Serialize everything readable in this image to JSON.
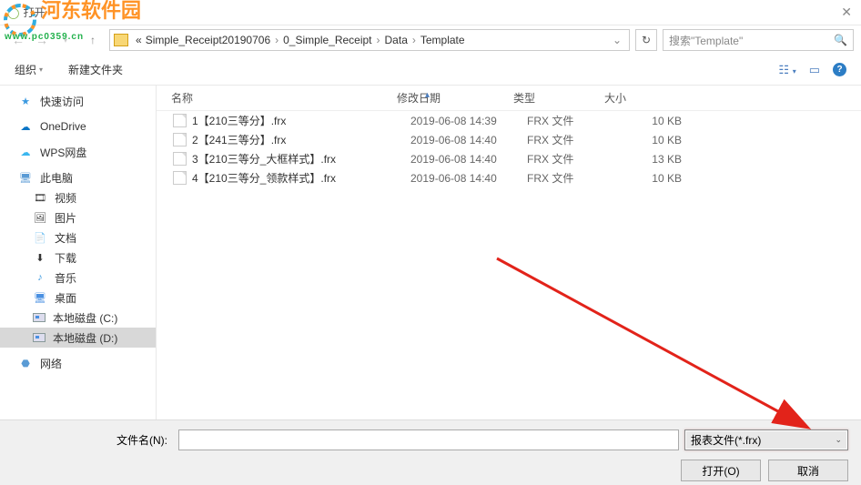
{
  "titlebar": {
    "title": "打开"
  },
  "breadcrumb": {
    "prefix": "«",
    "items": [
      "Simple_Receipt20190706",
      "0_Simple_Receipt",
      "Data",
      "Template"
    ]
  },
  "search": {
    "placeholder": "搜索\"Template\""
  },
  "toolbar": {
    "organize": "组织",
    "newfolder": "新建文件夹"
  },
  "sidebar": {
    "quick_access": "快速访问",
    "onedrive": "OneDrive",
    "wps": "WPS网盘",
    "this_pc": "此电脑",
    "videos": "视频",
    "pictures": "图片",
    "documents": "文档",
    "downloads": "下载",
    "music": "音乐",
    "desktop": "桌面",
    "drive_c": "本地磁盘 (C:)",
    "drive_d": "本地磁盘 (D:)",
    "network": "网络"
  },
  "columns": {
    "name": "名称",
    "modified": "修改日期",
    "type": "类型",
    "size": "大小"
  },
  "files": [
    {
      "name": "1【210三等分】.frx",
      "date": "2019-06-08 14:39",
      "type": "FRX 文件",
      "size": "10 KB"
    },
    {
      "name": "2【241三等分】.frx",
      "date": "2019-06-08 14:40",
      "type": "FRX 文件",
      "size": "10 KB"
    },
    {
      "name": "3【210三等分_大框样式】.frx",
      "date": "2019-06-08 14:40",
      "type": "FRX 文件",
      "size": "13 KB"
    },
    {
      "name": "4【210三等分_领款样式】.frx",
      "date": "2019-06-08 14:40",
      "type": "FRX 文件",
      "size": "10 KB"
    }
  ],
  "bottom": {
    "filename_label": "文件名(N):",
    "filetype": "报表文件(*.frx)",
    "open": "打开(O)",
    "cancel": "取消"
  },
  "watermark": {
    "main": "河东软件园",
    "sub": "www.pc0359.cn"
  }
}
